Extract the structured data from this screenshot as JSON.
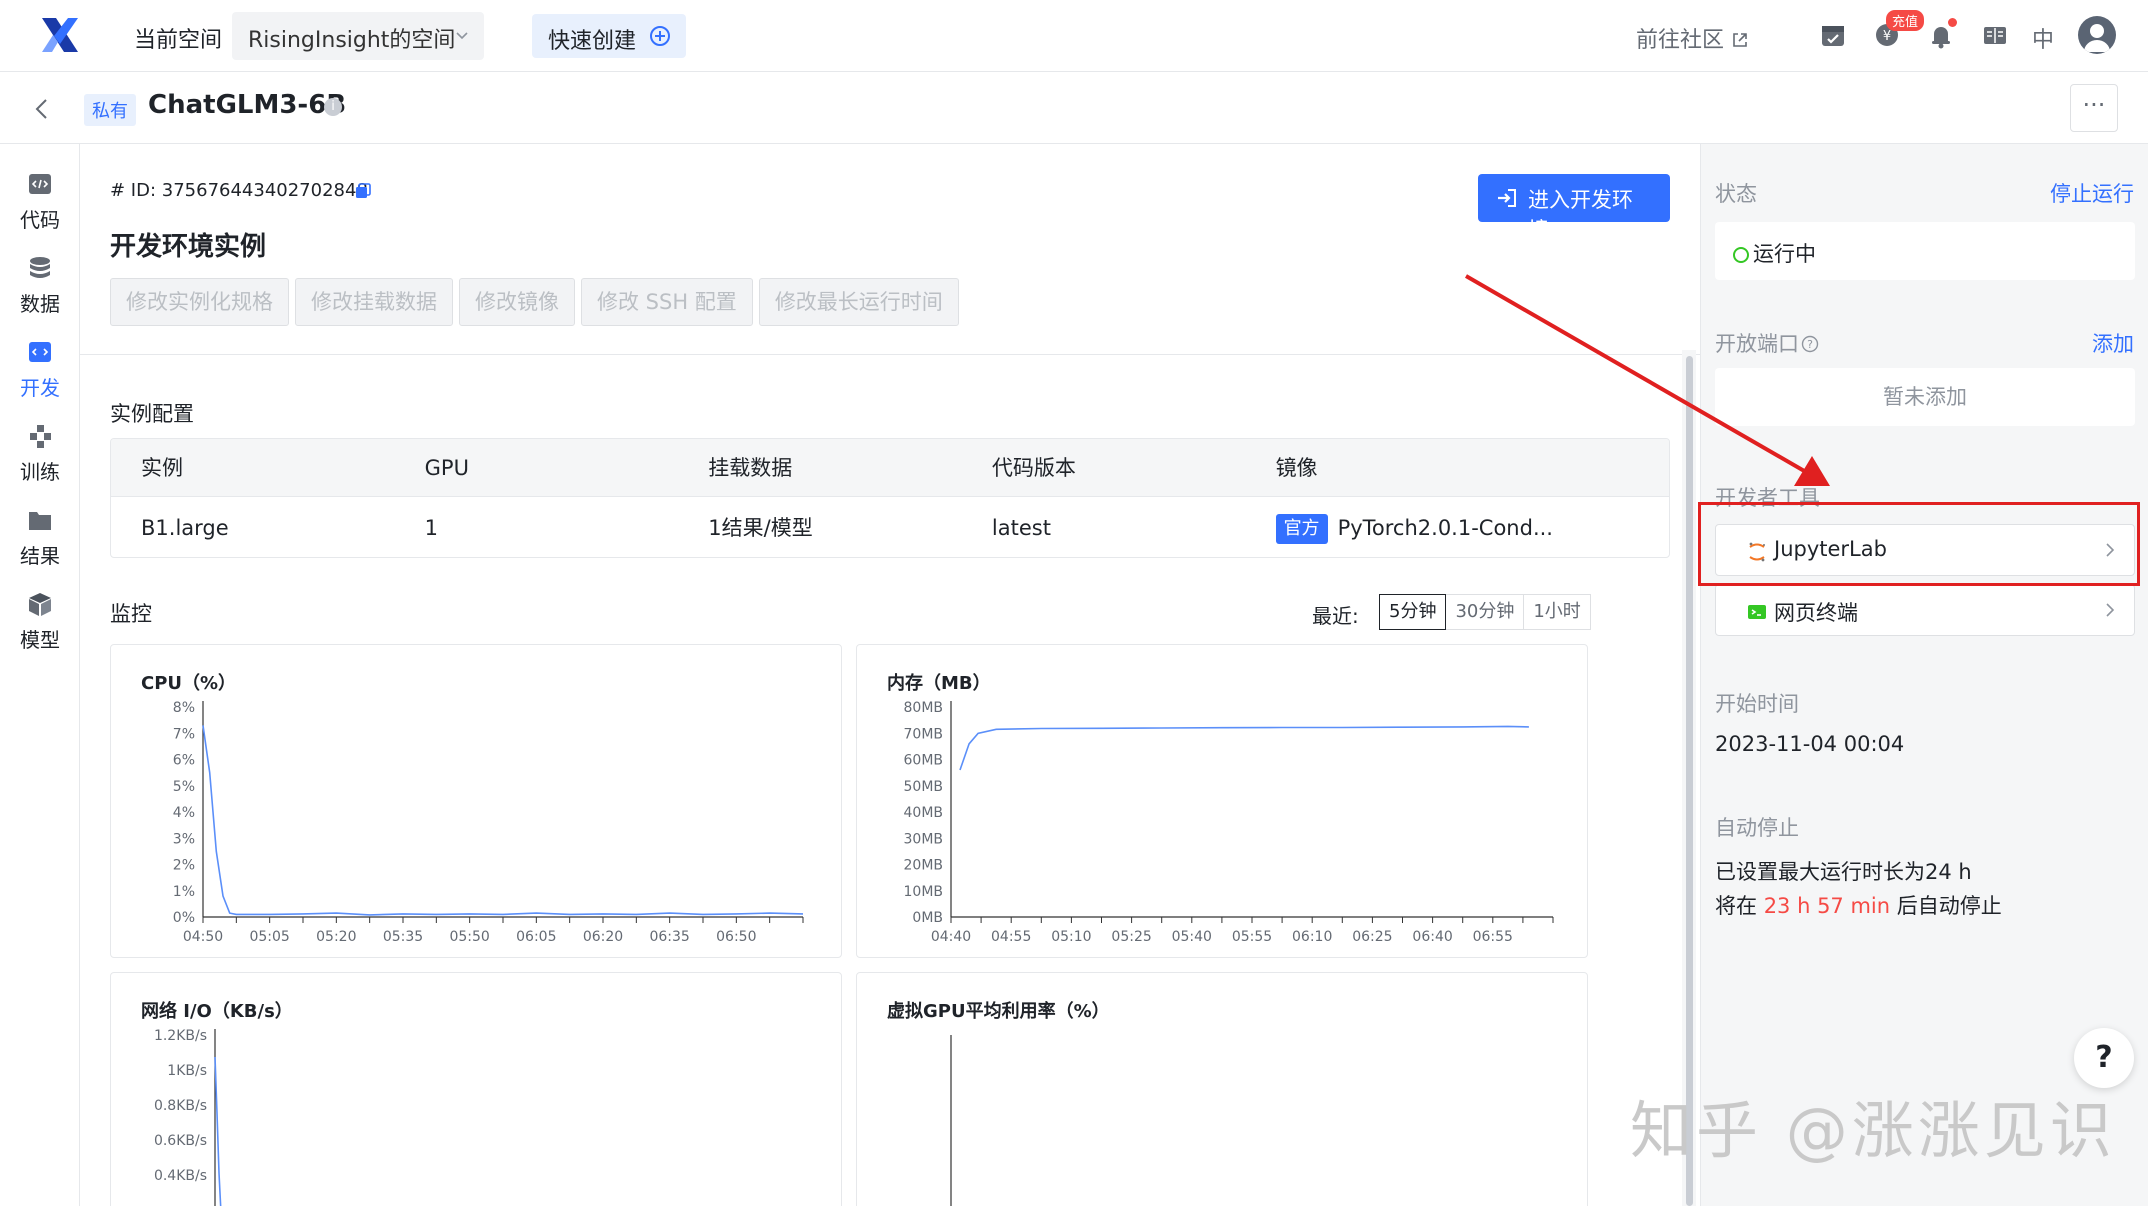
{
  "header": {
    "workspace_label": "当前空间",
    "workspace_name": "RisingInsight的空间",
    "quick_create": "快速创建",
    "community": "前往社区",
    "recharge_badge": "充值",
    "lang": "中"
  },
  "project": {
    "visibility": "私有",
    "title": "ChatGLM3-6B",
    "more": "···"
  },
  "nav": [
    {
      "label": "代码"
    },
    {
      "label": "数据"
    },
    {
      "label": "开发"
    },
    {
      "label": "训练"
    },
    {
      "label": "结果"
    },
    {
      "label": "模型"
    }
  ],
  "instance": {
    "id_line": "# ID: 375676443402702848",
    "title": "开发环境实例",
    "enter_button": "进入开发环境",
    "actions": [
      "修改实例化规格",
      "修改挂载数据",
      "修改镜像",
      "修改 SSH 配置",
      "修改最长运行时间"
    ]
  },
  "config": {
    "label": "实例配置",
    "columns": [
      "实例",
      "GPU",
      "挂载数据",
      "代码版本",
      "镜像"
    ],
    "row": [
      "B1.large",
      "1",
      "1结果/模型",
      "latest",
      "PyTorch2.0.1-Cond..."
    ],
    "official_tag": "官方"
  },
  "monitor": {
    "label": "监控",
    "recent_label": "最近:",
    "ranges": [
      "5分钟",
      "30分钟",
      "1小时"
    ],
    "selected_range": "5分钟"
  },
  "chart_data": [
    {
      "type": "line",
      "title": "CPU（%）",
      "x": [
        "04:50",
        "05:05",
        "05:20",
        "05:35",
        "05:50",
        "06:05",
        "06:20",
        "06:35",
        "06:50"
      ],
      "y_ticks": [
        "0%",
        "1%",
        "2%",
        "3%",
        "4%",
        "5%",
        "6%",
        "7%",
        "8%"
      ],
      "ylim": [
        0,
        8
      ],
      "points": [
        [
          0,
          7.3
        ],
        [
          0.2,
          5.5
        ],
        [
          0.4,
          2.5
        ],
        [
          0.6,
          0.8
        ],
        [
          0.8,
          0.15
        ],
        [
          1,
          0.1
        ],
        [
          2,
          0.1
        ],
        [
          3,
          0.12
        ],
        [
          4,
          0.15
        ],
        [
          5,
          0.08
        ],
        [
          6,
          0.12
        ],
        [
          7,
          0.1
        ],
        [
          8,
          0.12
        ],
        [
          9,
          0.1
        ],
        [
          10,
          0.15
        ],
        [
          11,
          0.1
        ],
        [
          12,
          0.12
        ],
        [
          13,
          0.1
        ],
        [
          14,
          0.15
        ],
        [
          15,
          0.1
        ],
        [
          16,
          0.12
        ],
        [
          17,
          0.15
        ],
        [
          18,
          0.12
        ]
      ],
      "x_extent": 18
    },
    {
      "type": "line",
      "title": "内存（MB）",
      "x": [
        "04:40",
        "04:55",
        "05:10",
        "05:25",
        "05:40",
        "05:55",
        "06:10",
        "06:25",
        "06:40",
        "06:55"
      ],
      "y_ticks": [
        "0MB",
        "10MB",
        "20MB",
        "30MB",
        "40MB",
        "50MB",
        "60MB",
        "70MB",
        "80MB"
      ],
      "ylim": [
        0,
        80
      ],
      "points": [
        [
          0.3,
          56
        ],
        [
          0.6,
          66
        ],
        [
          0.9,
          70
        ],
        [
          1.5,
          71.5
        ],
        [
          3,
          71.8
        ],
        [
          5,
          71.9
        ],
        [
          7,
          72
        ],
        [
          9,
          72.1
        ],
        [
          11,
          72.2
        ],
        [
          13,
          72.2
        ],
        [
          15,
          72.3
        ],
        [
          17,
          72.4
        ],
        [
          18.5,
          72.6
        ],
        [
          19.2,
          72.4
        ]
      ],
      "x_extent": 20
    },
    {
      "type": "line",
      "title": "网络 I/O（KB/s）",
      "y_ticks": [
        "0.4KB/s",
        "0.6KB/s",
        "0.8KB/s",
        "1KB/s",
        "1.2KB/s"
      ],
      "ylim": [
        0.2,
        1.2
      ]
    },
    {
      "type": "line",
      "title": "虚拟GPU平均利用率（%）"
    }
  ],
  "right_panel": {
    "status_label": "状态",
    "stop_link": "停止运行",
    "status_value": "运行中",
    "ports_label": "开放端口",
    "add_link": "添加",
    "ports_empty": "暂未添加",
    "tools_label": "开发者工具",
    "tools": [
      "JupyterLab",
      "网页终端"
    ],
    "start_label": "开始时间",
    "start_value": "2023-11-04 00:04",
    "auto_stop_label": "自动停止",
    "auto_stop_line1": "已设置最大运行时长为24 h",
    "auto_stop_prefix": "将在 ",
    "auto_stop_remaining": "23 h 57 min",
    "auto_stop_suffix": " 后自动停止",
    "help": "?"
  },
  "watermark": "知乎 @涨涨见识",
  "colors": {
    "accent": "#3370ff",
    "running": "#34c724",
    "alert": "#f54a45",
    "line": "#5b8ff9",
    "annotation": "#e02020"
  }
}
